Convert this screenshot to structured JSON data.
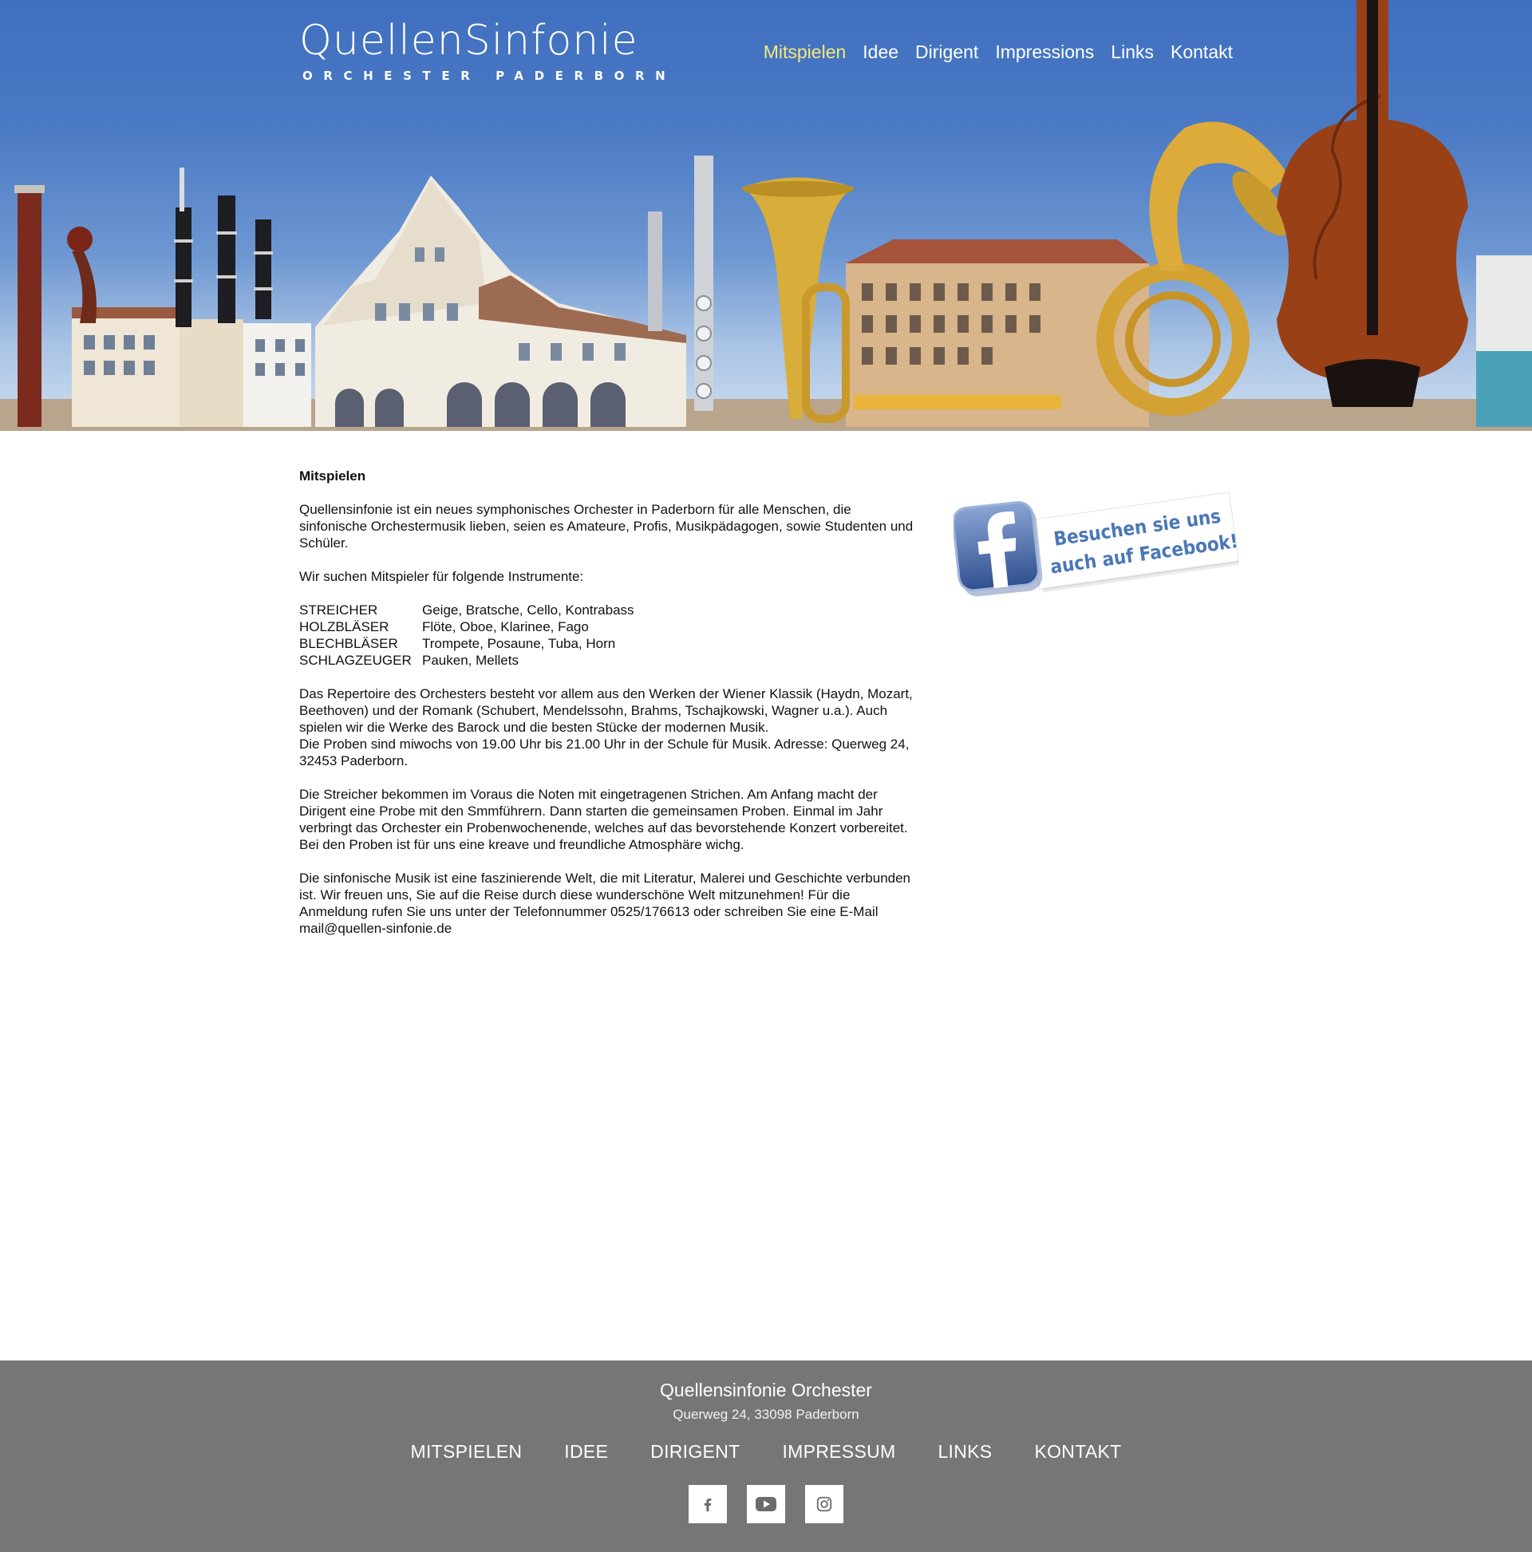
{
  "brand": {
    "logo_word": "QuellenSinfonie",
    "logo_sub": "ORCHESTER PADERBORN"
  },
  "nav": {
    "items": [
      {
        "label": "Mitspielen",
        "active": true
      },
      {
        "label": "Idee"
      },
      {
        "label": "Dirigent"
      },
      {
        "label": "Impressions"
      },
      {
        "label": "Links"
      },
      {
        "label": "Kontakt"
      }
    ],
    "active_color": "#f4ea7a"
  },
  "main": {
    "title": "Mitspielen",
    "intro": "Quellensinfonie ist ein neues symphonisches Orchester in Paderborn für alle Menschen, die sinfonische Orchestermusik lieben, seien es Amateure, Profis, Musikpädagogen, sowie Studenten und Schüler.",
    "search_line": "Wir suchen Mitspieler für folgende Instrumente:",
    "instruments": [
      {
        "group": "STREICHER",
        "list": "Geige, Bratsche, Cello, Kontrabass"
      },
      {
        "group": "HOLZBLÄSER",
        "list": "Flöte, Oboe, Klarinee, Fago"
      },
      {
        "group": "BLECHBLÄSER",
        "list": "Trompete, Posaune, Tuba, Horn"
      },
      {
        "group": "SCHLAGZEUGER",
        "list": "Pauken, Mellets"
      }
    ],
    "repertoire": "Das Repertoire des Orchesters besteht vor allem aus den Werken der Wiener Klassik (Haydn, Mozart, Beethoven) und der Romank (Schubert, Mendelssohn, Brahms, Tschajkowski, Wagner u.a.). Auch spielen wir die Werke des Barock und die besten Stücke der modernen Musik.",
    "rehearsal": "Die Proben sind miwochs von 19.00 Uhr bis 21.00 Uhr in der Schule für Musik. Adresse: Querweg 24, 32453 Paderborn.",
    "strings_note": "Die Streicher bekommen im Voraus die Noten mit eingetragenen Strichen. Am Anfang macht der Dirigent eine Probe mit den Smmführern. Dann starten die gemeinsamen Proben. Einmal im Jahr verbringt das Orchester ein Probenwochenende, welches auf das bevorstehende Konzert vorbereitet. Bei den Proben ist für uns eine kreave und freundliche Atmosphäre wichg.",
    "closing": "Die sinfonische Musik ist eine faszinierende Welt, die mit Literatur, Malerei und Geschichte verbunden ist. Wir freuen uns, Sie auf die Reise durch diese wunderschöne Welt mitzunehmen! Für die Anmeldung rufen Sie uns unter der Telefonnummer 0525/176613 oder schreiben Sie eine E-Mail mail@quellen-sinfonie.de"
  },
  "facebook_badge": {
    "line1": "Besuchen sie uns",
    "line2": "auch auf Facebook!",
    "icon": "facebook-icon"
  },
  "footer": {
    "org": "Quellensinfonie Orchester",
    "address": "Querweg 24, 33098 Paderborn",
    "nav": [
      "MITSPIELEN",
      "IDEE",
      "DIRIGENT",
      "IMPRESSUM",
      "LINKS",
      "KONTAKT"
    ],
    "social": [
      "facebook-icon",
      "youtube-icon",
      "instagram-icon"
    ],
    "bg_color": "#767676"
  },
  "colors": {
    "sky_top": "#3f6fbf",
    "badge_text": "#4a77b8"
  }
}
